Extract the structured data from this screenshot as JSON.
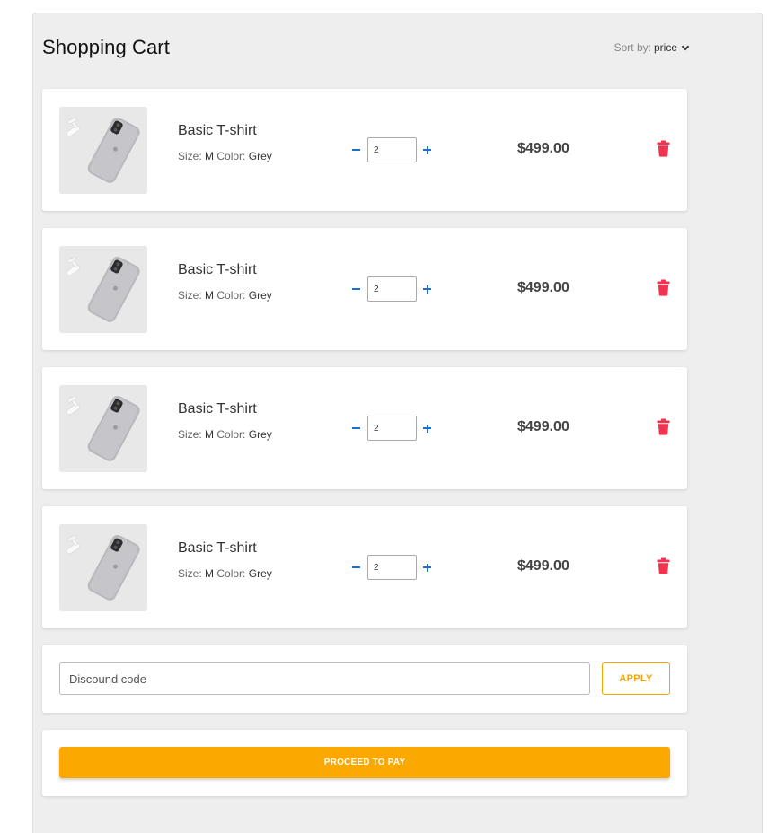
{
  "header": {
    "title": "Shopping Cart",
    "sort_label": "Sort by:",
    "sort_value": "price"
  },
  "items": [
    {
      "name": "Basic T-shirt",
      "size_label": "Size:",
      "size": "M",
      "color_label": "Color:",
      "color": "Grey",
      "quantity": "2",
      "price": "$499.00"
    },
    {
      "name": "Basic T-shirt",
      "size_label": "Size:",
      "size": "M",
      "color_label": "Color:",
      "color": "Grey",
      "quantity": "2",
      "price": "$499.00"
    },
    {
      "name": "Basic T-shirt",
      "size_label": "Size:",
      "size": "M",
      "color_label": "Color:",
      "color": "Grey",
      "quantity": "2",
      "price": "$499.00"
    },
    {
      "name": "Basic T-shirt",
      "size_label": "Size:",
      "size": "M",
      "color_label": "Color:",
      "color": "Grey",
      "quantity": "2",
      "price": "$499.00"
    }
  ],
  "discount": {
    "placeholder": "Discound code",
    "apply_label": "APPLY"
  },
  "checkout": {
    "pay_label": "PROCEED TO PAY"
  },
  "colors": {
    "accent": "#fba800",
    "delete": "#f0344f",
    "qty_control": "#1a6fd6"
  },
  "icons": {
    "product_image": "phone-product-image",
    "delete": "trash-icon",
    "minus": "minus-icon",
    "plus": "plus-icon",
    "sort": "chevron-down-icon"
  }
}
